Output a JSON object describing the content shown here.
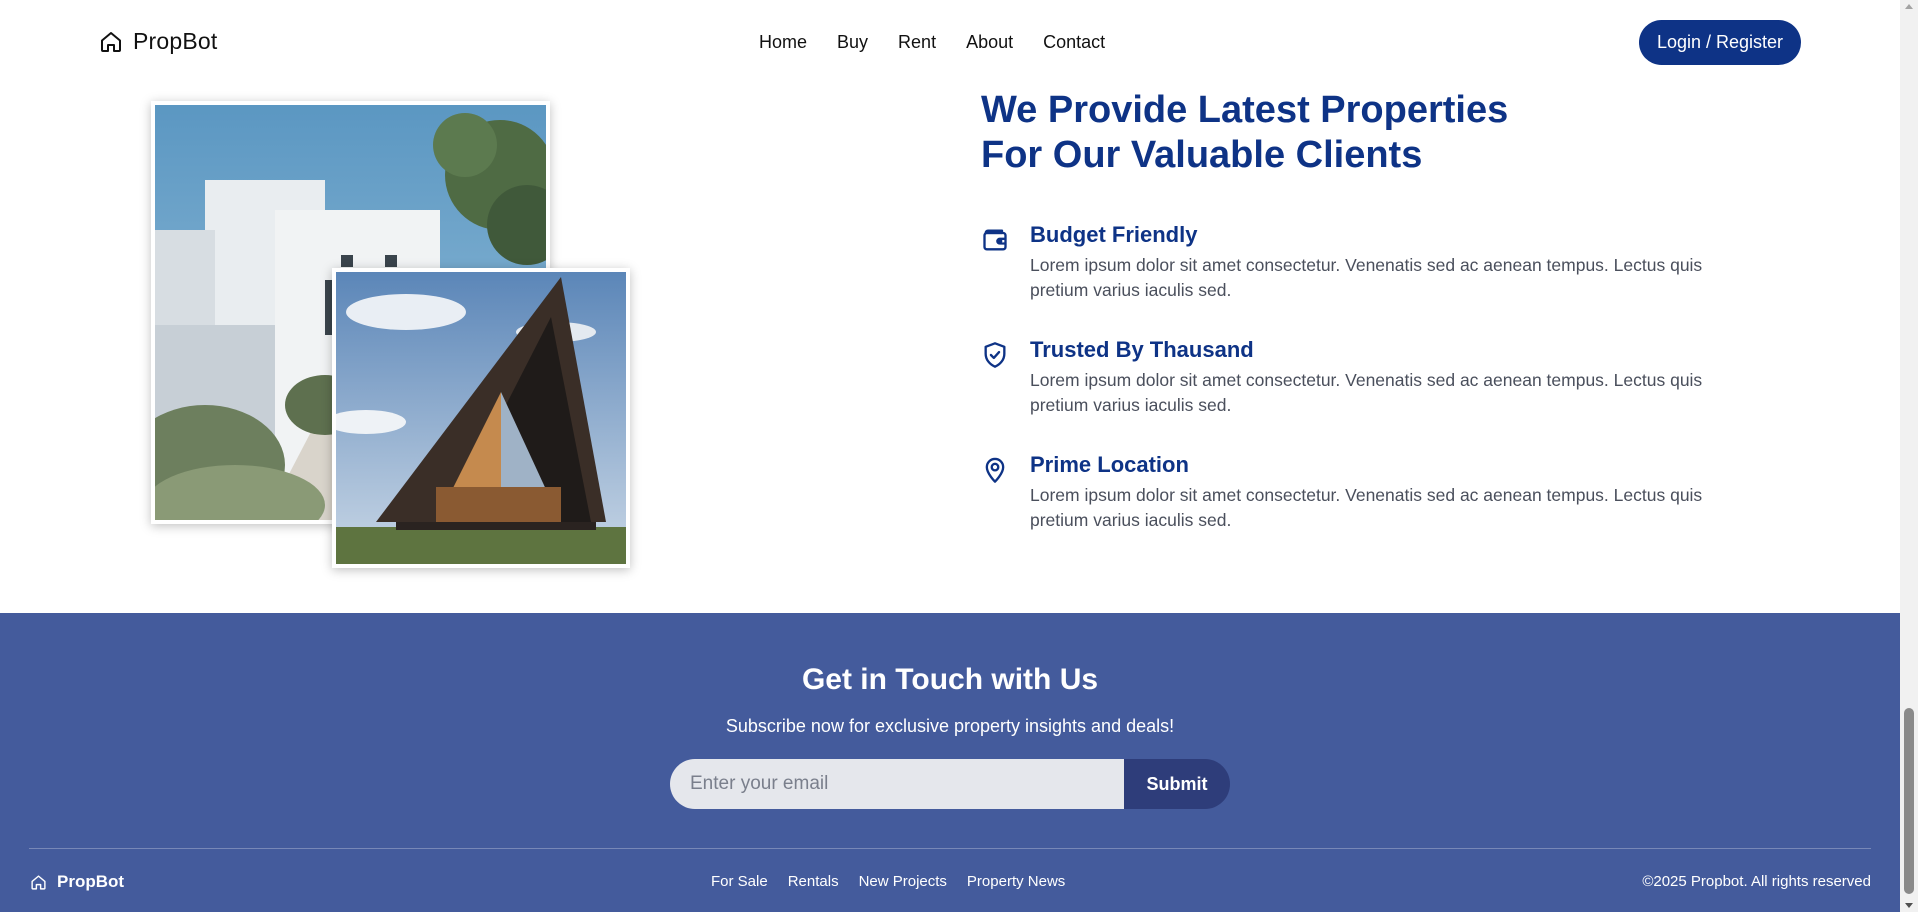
{
  "nav": {
    "brand": "PropBot",
    "brand_icon": "home-icon",
    "links": [
      "Home",
      "Buy",
      "Rent",
      "About",
      "Contact"
    ],
    "login_label": "Login / Register"
  },
  "colors": {
    "primary": "#0e3386",
    "contact_bg": "#445b9c",
    "submit_bg": "#2e3d7a",
    "body_text": "#4a4f5c"
  },
  "about": {
    "headline_line1": "We Provide Latest Properties",
    "headline_line2": "For Our Valuable Clients",
    "features": [
      {
        "icon": "wallet-icon",
        "title": "Budget Friendly",
        "desc": "Lorem ipsum dolor sit amet consectetur. Venenatis sed ac aenean tempus. Lectus quis pretium varius iaculis sed."
      },
      {
        "icon": "shield-check-icon",
        "title": "Trusted By Thausand",
        "desc": "Lorem ipsum dolor sit amet consectetur. Venenatis sed ac aenean tempus. Lectus quis pretium varius iaculis sed."
      },
      {
        "icon": "map-pin-icon",
        "title": "Prime Location",
        "desc": "Lorem ipsum dolor sit amet consectetur. Venenatis sed ac aenean tempus. Lectus quis pretium varius iaculis sed."
      }
    ]
  },
  "contact": {
    "title": "Get in Touch with Us",
    "subtitle": "Subscribe now for exclusive property insights and deals!",
    "email_placeholder": "Enter your email",
    "submit_label": "Submit"
  },
  "footer": {
    "brand": "PropBot",
    "links": [
      "For Sale",
      "Rentals",
      "New Projects",
      "Property News"
    ],
    "copyright": "©2025 Propbot. All rights reserved"
  }
}
